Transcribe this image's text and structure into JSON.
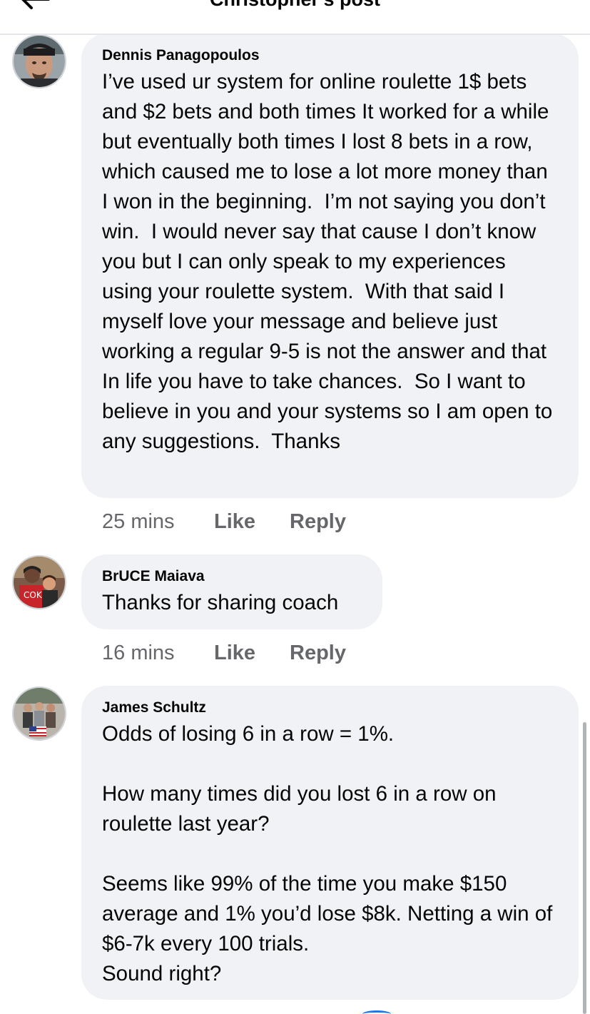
{
  "header": {
    "title": "Christopher's post",
    "back_icon": "arrow-left-icon"
  },
  "comments": [
    {
      "author": "Dennis Panagopoulos",
      "text": "I’ve used ur system for online roulette 1$ bets and $2 bets and both times It worked for a while but eventually both times I lost 8 bets in a row, which caused me to lose a lot more money than I won in the beginning.  I’m not saying you don’t win.  I would never say that cause I don’t know you but I can only speak to my experiences using your roulette system.  With that said I myself love your message and believe just working a regular 9-5 is not the answer and that In life you have to take chances.  So I want to believe in you and your systems so I am open to any suggestions.  Thanks",
      "time": "25 mins",
      "like_label": "Like",
      "reply_label": "Reply"
    },
    {
      "author": "BrUCE Maiava",
      "text": "Thanks for sharing coach",
      "time": "16 mins",
      "like_label": "Like",
      "reply_label": "Reply"
    },
    {
      "author": "James Schultz",
      "text": "Odds of losing 6 in a row = 1%.\n\nHow many times did you lost 6 in a row on roulette last year?\n\nSeems like 99% of the time you make $150 average and 1% you’d lose $8k. Netting a win of $6-7k every 100 trials.\nSound right?"
    }
  ],
  "colors": {
    "bubble": "#f0f2f5",
    "meta_text": "#65676b",
    "text": "#050505",
    "accent": "#1877f2"
  }
}
